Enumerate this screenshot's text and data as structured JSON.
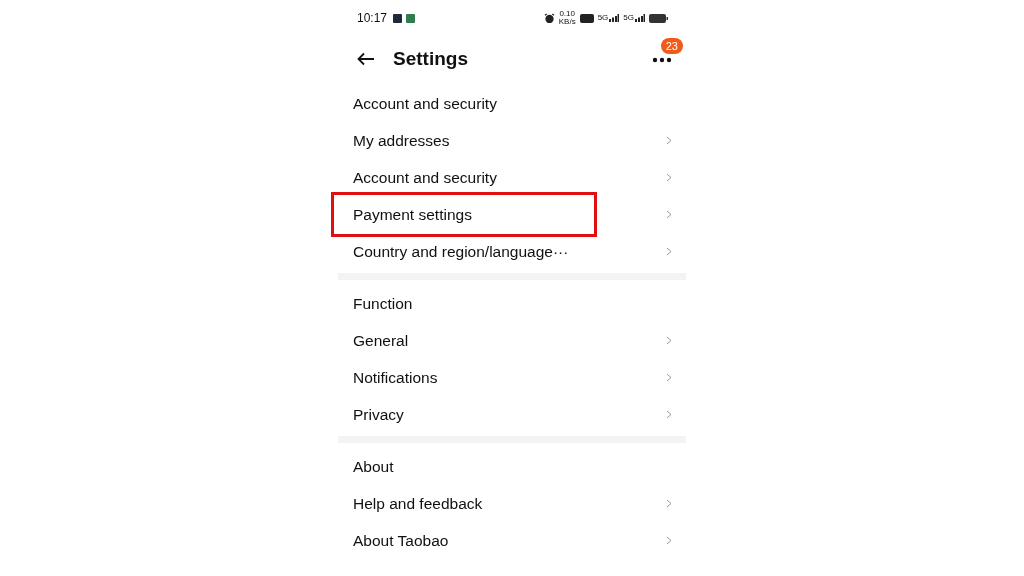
{
  "status_bar": {
    "time": "10:17",
    "speed_value": "0.10",
    "speed_unit": "KB/s",
    "sim_labels": [
      "5G",
      "5G"
    ]
  },
  "header": {
    "title": "Settings",
    "badge": "23"
  },
  "sections": [
    {
      "title": "Account and security",
      "items": [
        {
          "label": "My addresses",
          "highlighted": false
        },
        {
          "label": "Account and security",
          "highlighted": false
        },
        {
          "label": "Payment settings",
          "highlighted": true
        },
        {
          "label": "Country and region/language···",
          "highlighted": false
        }
      ]
    },
    {
      "title": "Function",
      "items": [
        {
          "label": "General",
          "highlighted": false
        },
        {
          "label": "Notifications",
          "highlighted": false
        },
        {
          "label": "Privacy",
          "highlighted": false
        }
      ]
    },
    {
      "title": "About",
      "items": [
        {
          "label": "Help and feedback",
          "highlighted": false
        },
        {
          "label": "About Taobao",
          "highlighted": false
        }
      ]
    }
  ]
}
